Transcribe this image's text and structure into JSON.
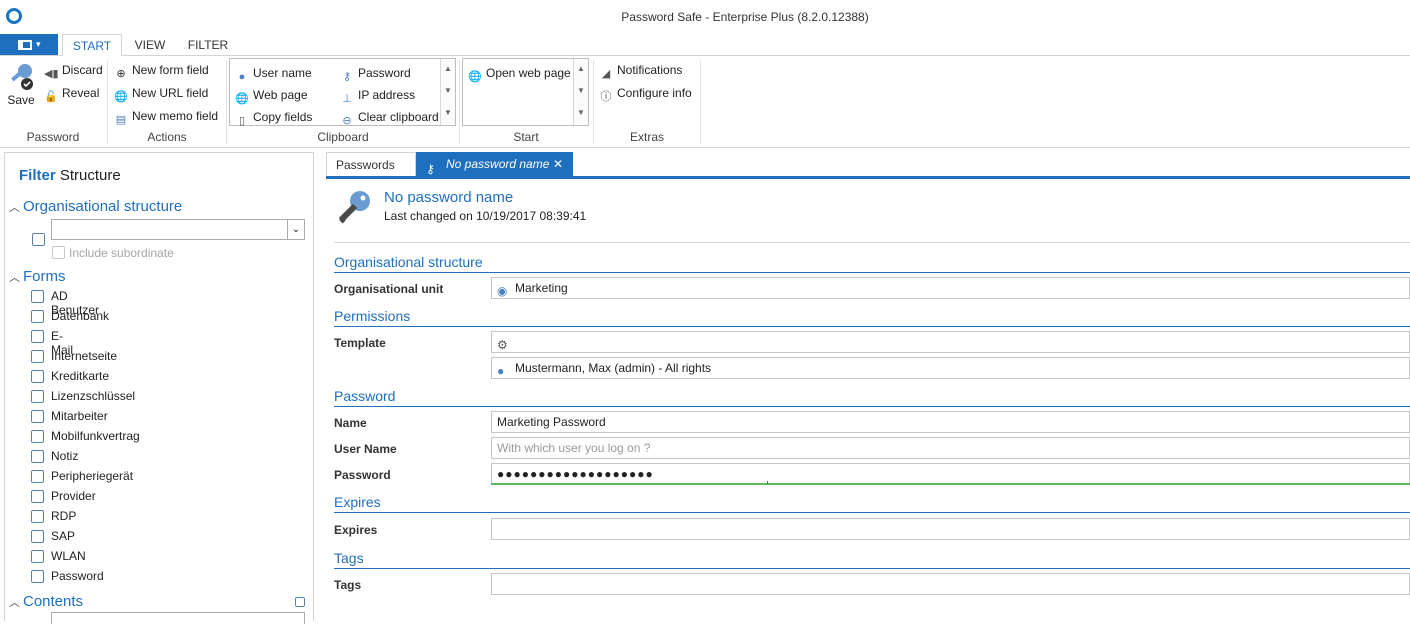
{
  "window": {
    "title": "Password Safe - Enterprise Plus (8.2.0.12388)"
  },
  "ribbon": {
    "tabs": [
      "START",
      "VIEW",
      "FILTER"
    ],
    "active_tab": "START",
    "password_group": {
      "label": "Password",
      "save": "Save",
      "discard": "Discard",
      "reveal": "Reveal"
    },
    "actions_group": {
      "label": "Actions",
      "new_form_field": "New form field",
      "new_url_field": "New URL field",
      "new_memo_field": "New memo field"
    },
    "clipboard_group": {
      "label": "Clipboard",
      "user_name": "User name",
      "password": "Password",
      "web_page": "Web page",
      "ip_address": "IP address",
      "copy_fields": "Copy fields",
      "clear_clipboard": "Clear clipboard"
    },
    "start_group": {
      "label": "Start",
      "open_web_page": "Open web page"
    },
    "extras_group": {
      "label": "Extras",
      "notifications": "Notifications",
      "configure_info": "Configure info"
    }
  },
  "left_panel": {
    "tabs": {
      "filter": "Filter",
      "structure": "Structure"
    },
    "org_structure": {
      "title": "Organisational structure",
      "include_subordinate": "Include subordinate"
    },
    "forms": {
      "title": "Forms",
      "items": [
        "AD Benutzer",
        "Datenbank",
        "E-Mail",
        "Internetseite",
        "Kreditkarte",
        "Lizenzschlüssel",
        "Mitarbeiter",
        "Mobilfunkvertrag",
        "Notiz",
        "Peripheriegerät",
        "Provider",
        "RDP",
        "SAP",
        "WLAN",
        "Password"
      ]
    },
    "contents": {
      "title": "Contents"
    }
  },
  "content": {
    "tabs": {
      "passwords": "Passwords",
      "active": "No password name"
    },
    "header": {
      "title": "No password name",
      "subtitle": "Last changed on 10/19/2017 08:39:41"
    },
    "sections": {
      "org_structure": {
        "title": "Organisational structure",
        "org_unit_label": "Organisational unit",
        "org_unit_value": "Marketing"
      },
      "permissions": {
        "title": "Permissions",
        "template_label": "Template",
        "template_value": "",
        "permission_value": "Mustermann, Max (admin) - All rights"
      },
      "password": {
        "title": "Password",
        "name_label": "Name",
        "name_value": "Marketing Password",
        "username_label": "User Name",
        "username_placeholder": "With which user you log on ?",
        "password_label": "Password",
        "password_value": "●●●●●●●●●●●●●●●●●●●",
        "strength_fraction": 0.3
      },
      "expires": {
        "title": "Expires",
        "label": "Expires",
        "value": ""
      },
      "tags": {
        "title": "Tags",
        "label": "Tags",
        "value": ""
      }
    }
  },
  "colors": {
    "accent": "#1f6fbf",
    "strength": "#5fb85f"
  }
}
